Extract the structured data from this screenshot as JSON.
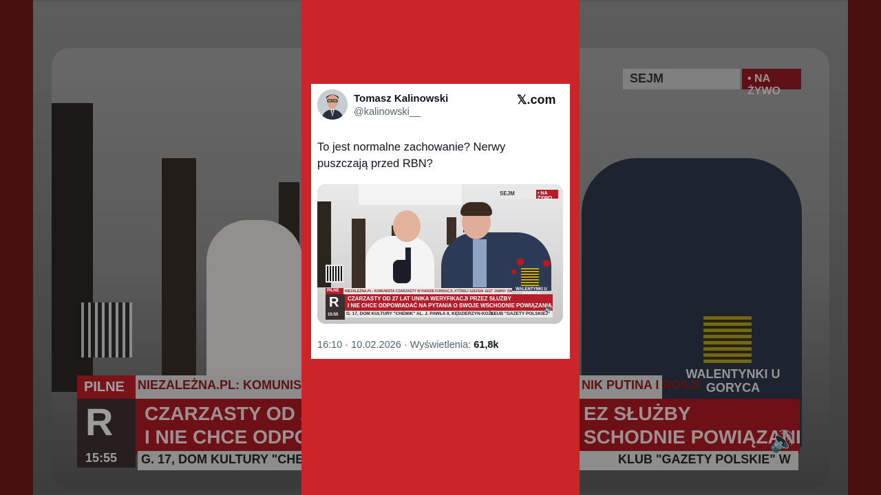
{
  "background": {
    "sejm_label": "SEJM",
    "live_label": "• NA ŻYWO",
    "pilne": "PILNE",
    "niezalezna_left": "NIEZALEŻNA.PL: KOMUNISTA CZARZA",
    "niezalezna_right": "NIK PUTINA I ROSJI",
    "headline_left_1": "CZARZASTY OD 2",
    "headline_left_2": "I NIE CHCE ODPOW",
    "headline_right_1": "EZ SŁUŻBY",
    "headline_right_2": "SCHODNIE POWIĄZANI",
    "logo_letter": "R",
    "time": "15:55",
    "ticker_left": "G. 17, DOM KULTURY \"CHE",
    "ticker_right": "KLUB \"GAZETY POLSKIE\" W",
    "walentynki": "WALENTYNKI U GORYCA",
    "accent": "#cc2529"
  },
  "tweet": {
    "author_name": "Tomasz Kalinowski",
    "author_handle": "@kalinowski__",
    "site_label": "𝕏.com",
    "text": "To jest normalne zachowanie? Nerwy puszczają przed RBN?",
    "time": "16:10",
    "date": "10.02.2026",
    "views_label": "Wyświetlenia:",
    "views": "61,8k",
    "meta_sep": " · "
  },
  "media": {
    "sejm_label": "SEJM",
    "live_label": "• NA ŻYWO",
    "pilne": "PILNE",
    "niezalezna": "NIEZALEŻNA.PL: KOMUNISTA CZARZASTY W RADZIE FUNDACJI, KTÓREJ SZEFEM JEST JAWNY ZWOLENNIK PUTINA I ROSJI",
    "headline_1": "CZARZASTY OD 27 LAT UNIKA WERYFIKACJI PRZEZ SŁUŻBY",
    "headline_2": "I NIE CHCE ODPOWIADAĆ NA PYTANIA O SWOJE WSCHODNIE POWIĄZANIA",
    "logo_letter": "R",
    "time": "15:55",
    "ticker_left": "G. 17, DOM KULTURY \"CHEMIK\" AL. J. PAWŁA II, KĘDZIERZYN-KOŹLE",
    "ticker_right": "KLUB \"GAZETY POLSKIEJ\"",
    "walentynki": "WALENTYNKI U GORYCA"
  }
}
